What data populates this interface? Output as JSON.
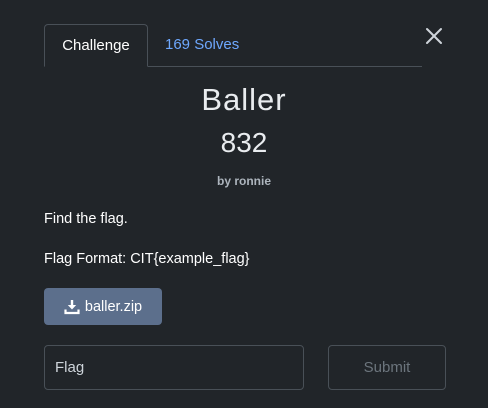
{
  "tabs": [
    {
      "label": "Challenge",
      "active": true
    },
    {
      "label": "169 Solves",
      "active": false
    }
  ],
  "close_icon": "close-icon",
  "challenge": {
    "name": "Baller",
    "points": "832",
    "author_prefix": "by",
    "author": "ronnie",
    "description_lines": [
      "Find the flag.",
      "Flag Format: CIT{example_flag}"
    ]
  },
  "files": [
    {
      "label": "baller.zip",
      "icon": "download-icon"
    }
  ],
  "form": {
    "flag_placeholder": "Flag",
    "submit_label": "Submit"
  },
  "colors": {
    "background": "#212529",
    "link": "#6ea8fe",
    "download_button": "#5c6f8c",
    "border": "#495057"
  }
}
